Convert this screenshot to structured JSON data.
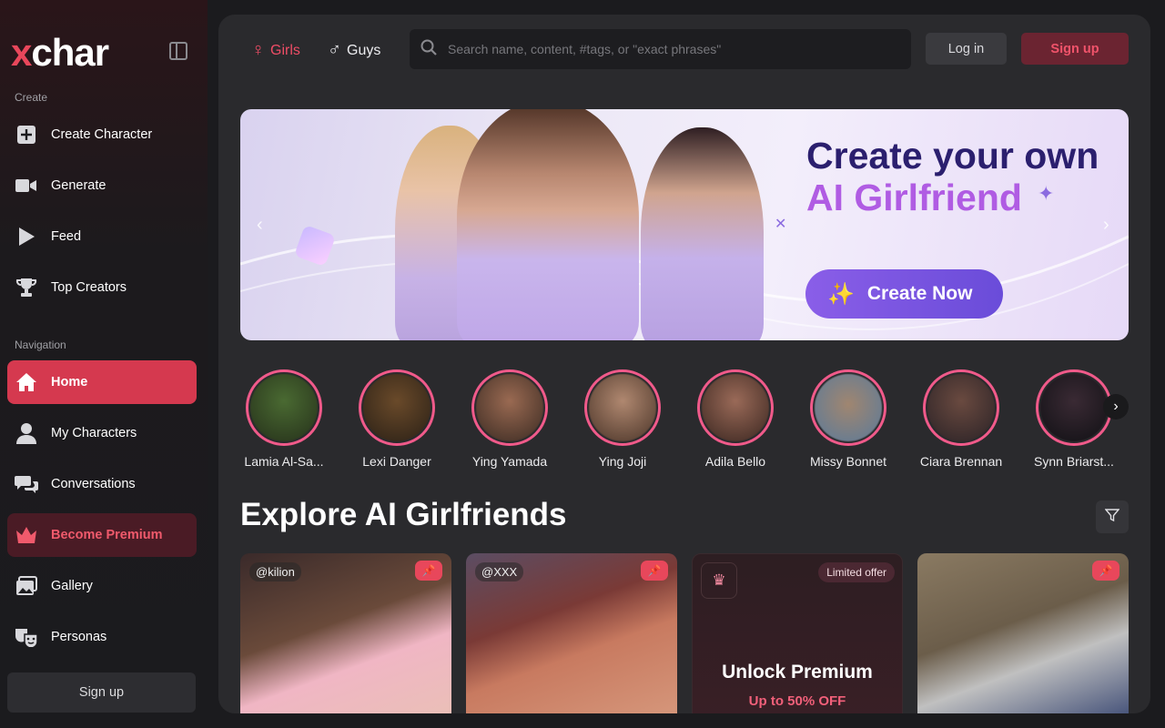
{
  "app": {
    "logo_x": "x",
    "logo_rest": "char"
  },
  "sidebar": {
    "create_label": "Create",
    "nav_label": "Navigation",
    "create_items": [
      {
        "label": "Create Character",
        "icon": "plus-square-icon"
      },
      {
        "label": "Generate",
        "icon": "video-camera-icon"
      },
      {
        "label": "Feed",
        "icon": "play-icon"
      },
      {
        "label": "Top Creators",
        "icon": "trophy-icon"
      }
    ],
    "nav_items": [
      {
        "label": "Home",
        "icon": "home-icon",
        "active": true
      },
      {
        "label": "My Characters",
        "icon": "user-icon"
      },
      {
        "label": "Conversations",
        "icon": "chat-icon"
      },
      {
        "label": "Become Premium",
        "icon": "crown-icon"
      },
      {
        "label": "Gallery",
        "icon": "gallery-icon"
      },
      {
        "label": "Personas",
        "icon": "masks-icon"
      }
    ],
    "signup": "Sign up"
  },
  "topbar": {
    "girls": "Girls",
    "guys": "Guys",
    "search_placeholder": "Search name, content, #tags, or \"exact phrases\"",
    "login": "Log in",
    "signup": "Sign up"
  },
  "banner": {
    "title_line1": "Create your own",
    "title_line2": "AI Girlfriend",
    "cta": "Create Now"
  },
  "stories": [
    {
      "name": "Lamia Al-Sa...",
      "color": "#3a5a2a"
    },
    {
      "name": "Lexi Danger",
      "color": "#4a3a22"
    },
    {
      "name": "Ying Yamada",
      "color": "#6a4a3a"
    },
    {
      "name": "Ying Joji",
      "color": "#7a5a48"
    },
    {
      "name": "Adila Bello",
      "color": "#6a4a42"
    },
    {
      "name": "Missy Bonnet",
      "color": "#5a7a9a"
    },
    {
      "name": "Ciara Brennan",
      "color": "#4a3a3a"
    },
    {
      "name": "Synn Briarst...",
      "color": "#1a1a24"
    }
  ],
  "explore": {
    "title": "Explore AI Girlfriends"
  },
  "cards": [
    {
      "handle": "@kilion"
    },
    {
      "handle": "@XXX"
    },
    {
      "offer": "Limited offer",
      "unlock": "Unlock Premium",
      "discount": "Up to 50% OFF"
    },
    {
      "handle": ""
    }
  ],
  "colors": {
    "accent": "#e8475b",
    "premium_bg": "#4a1b25",
    "banner_title": "#2b1f6e",
    "banner_accent": "#b05ce3"
  }
}
